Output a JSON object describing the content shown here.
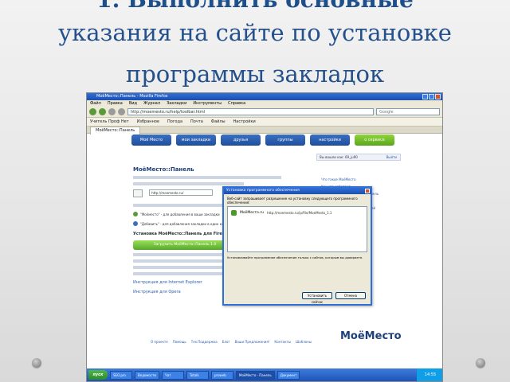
{
  "slide": {
    "title_line1": "1. Выполнить основные",
    "title_line2": "указания на сайте по установке",
    "title_line3": "программы закладок"
  },
  "browser": {
    "window_title": "МоёМесто::Панель - Mozilla Firefox",
    "menu": [
      "Файл",
      "Правка",
      "Вид",
      "Журнал",
      "Закладки",
      "Инструменты",
      "Справка"
    ],
    "address": "http://moemesto.ru/help/toolbar.html",
    "search_placeholder": "Google",
    "bookmarks": [
      "Учитель Проф Нет",
      "Избранное",
      "Погода",
      "Почта",
      "Файлы",
      "Настройки"
    ],
    "tab_label": "МоёМесто::Панель"
  },
  "site": {
    "nav": [
      "Моё Место",
      "мои закладки",
      "друзья",
      "группы",
      "настройки",
      "о сервисе"
    ],
    "user_label": "Вы вошли как:",
    "user_name": "69_ju90",
    "user_link": "Выйти",
    "page_title": "МоёМесто::Панель",
    "url_field": "http://moemesto.ru/",
    "item1": "\"Моёместо\" - для добавления в ваши закладки",
    "item2": "\"Добавить\" - для добавления закладки в один клик",
    "install_head": "Установка МоёМесто::Панель для Firefox",
    "install_button": "Загрузить МоёМесто::Панель 1.0",
    "link_ie": "Инструкция для Internet Explorer",
    "link_opera": "Инструкция для Opera",
    "sidebar": [
      "Что такое МоёМесто",
      "Как это работает",
      "Как добавлять закладки в панель",
      "Как импортировать",
      "Расширение для пользователей",
      "Лента RSS",
      "Мои любимые закладки",
      "Как добавить блог",
      "Популярные теги"
    ],
    "footer": [
      "О проекте",
      "Помощь",
      "Тех.Поддержка",
      "Блог",
      "Ваши Предложения!",
      "Контакты",
      "Шаблоны"
    ],
    "brand": "МоёМесто"
  },
  "dialog": {
    "title": "Установка программного обеспечения",
    "prompt": "Веб-сайт запрашивает разрешение на установку следующего программного обеспечения:",
    "item_name": "МоёМесто.ru",
    "item_url": "http://moemesto.ru/ip/file/MoeMesto_1.1",
    "warning": "Устанавливайте программное обеспечение только с сайтов, которым вы доверяете.",
    "cancel": "Отмена",
    "install": "Установить сейчас"
  },
  "taskbar": {
    "start": "пуск",
    "tasks": [
      "SEO.pro",
      "Ведомости",
      "Чат",
      "Totalk",
      "proweb",
      "МоёМесто - Панель",
      "Документ"
    ],
    "clock": "14:55"
  }
}
